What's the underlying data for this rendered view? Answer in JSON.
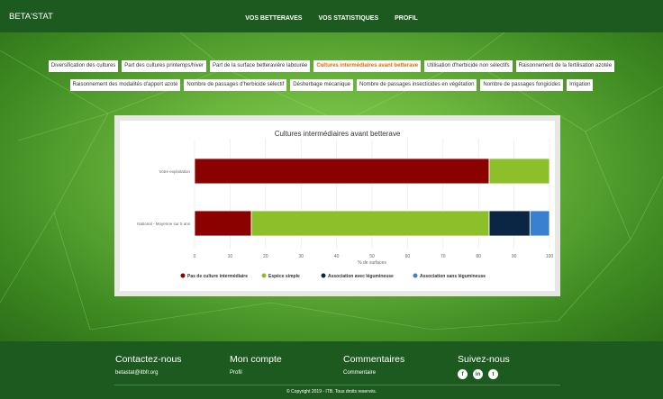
{
  "header": {
    "brand": "BETA'STAT",
    "nav": [
      "VOS BETTERAVES",
      "VOS STATISTIQUES",
      "PROFIL"
    ]
  },
  "tabs": {
    "row1": [
      {
        "label": "Diversification des cultures",
        "active": false
      },
      {
        "label": "Part des cultures printemps/hiver",
        "active": false
      },
      {
        "label": "Part de la surface betteravière labourée",
        "active": false
      },
      {
        "label": "Cultures intermédiaires avant betterave",
        "active": true
      },
      {
        "label": "Utilisation d'herbicide non sélectifs",
        "active": false
      },
      {
        "label": "Raisonnement de la fertilisation azotée",
        "active": false
      }
    ],
    "row2": [
      {
        "label": "Raisonnement des modalités d'apport azoté",
        "active": false
      },
      {
        "label": "Nombre de passages d'herbicide sélectif",
        "active": false
      },
      {
        "label": "Désherbage mécanique",
        "active": false
      },
      {
        "label": "Nombre de passages insecticides en végétation",
        "active": false
      },
      {
        "label": "Nombre de passages fongicides",
        "active": false
      },
      {
        "label": "Irrigation",
        "active": false
      }
    ]
  },
  "chart_data": {
    "type": "bar",
    "orientation": "horizontal",
    "stacked": true,
    "title": "Cultures intermédiaires avant betterave",
    "xlabel": "% de surfaces",
    "ylabel": "",
    "xlim": [
      0,
      100
    ],
    "xticks": [
      0,
      10,
      20,
      30,
      40,
      50,
      60,
      70,
      80,
      90,
      100
    ],
    "categories": [
      "Votre exploitation",
      "National - Moyenne sur 5 ans"
    ],
    "series": [
      {
        "name": "Pas de culture intermédiaire",
        "color": "#8b0000",
        "values": [
          83,
          16
        ]
      },
      {
        "name": "Espèce simple",
        "color": "#8dbf2b",
        "values": [
          17,
          67
        ]
      },
      {
        "name": "Association avec légumineuse",
        "color": "#0b2545",
        "values": [
          0,
          11.5
        ]
      },
      {
        "name": "Association sans légumineuse",
        "color": "#3a80d0",
        "values": [
          0,
          5.5
        ]
      }
    ],
    "legend_position": "bottom",
    "grid": true
  },
  "footer": {
    "contact_title": "Contactez-nous",
    "contact_email": "betastat@itbfr.org",
    "account_title": "Mon compte",
    "account_link": "Profil",
    "comments_title": "Commentaires",
    "comments_link": "Commentaire",
    "follow_title": "Suivez-nous",
    "social": [
      {
        "icon": "facebook-icon",
        "glyph": "f"
      },
      {
        "icon": "linkedin-icon",
        "glyph": "in"
      },
      {
        "icon": "twitter-icon",
        "glyph": "t"
      }
    ],
    "copyright": "© Copyright 2019 - ITB. Tous droits reservés."
  }
}
